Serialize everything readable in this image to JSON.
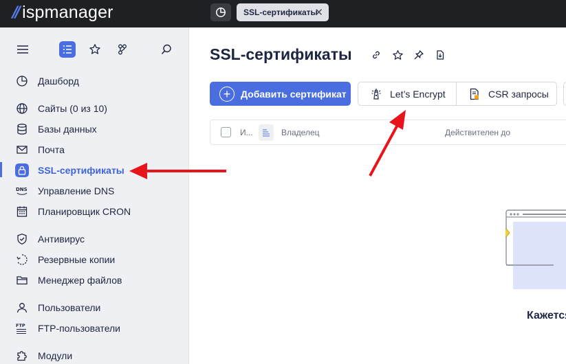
{
  "app": {
    "logo_text": "ispmanager"
  },
  "topbar": {
    "tab_label": "SSL-сертификаты",
    "tab_close": "✕"
  },
  "sidebar": {
    "items": [
      {
        "label": "Дашборд",
        "icon": "dashboard-icon"
      },
      {
        "label": "Сайты (0 из 10)",
        "icon": "globe-icon"
      },
      {
        "label": "Базы данных",
        "icon": "database-icon"
      },
      {
        "label": "Почта",
        "icon": "mail-icon"
      },
      {
        "label": "SSL-сертификаты",
        "icon": "lock-icon",
        "active": true
      },
      {
        "label": "Управление DNS",
        "icon": "dns-icon"
      },
      {
        "label": "Планировщик CRON",
        "icon": "calendar-icon"
      },
      {
        "label": "Антивирус",
        "icon": "shield-icon"
      },
      {
        "label": "Резервные копии",
        "icon": "backup-icon"
      },
      {
        "label": "Менеджер файлов",
        "icon": "folder-icon"
      },
      {
        "label": "Пользователи",
        "icon": "user-icon"
      },
      {
        "label": "FTP-пользователи",
        "icon": "ftp-icon"
      },
      {
        "label": "Модули",
        "icon": "puzzle-icon"
      }
    ]
  },
  "main": {
    "title": "SSL-сертификаты",
    "add_button": "Добавить сертификат",
    "letsencrypt_button": "Let’s Encrypt",
    "csr_button": "CSR запросы",
    "table": {
      "col_name": "И...",
      "col_owner": "Владелец",
      "col_valid": "Действителен до"
    },
    "empty_text": "Кажется"
  },
  "colors": {
    "accent": "#4a6ee0",
    "topbar": "#1f2023",
    "annotation_arrow": "#e8141b"
  }
}
